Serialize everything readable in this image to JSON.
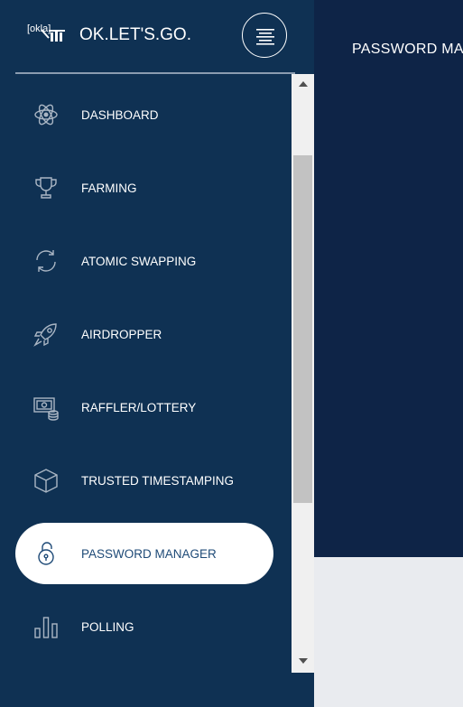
{
  "brand": {
    "logo_text": "[okla]",
    "name": "OK.LET'S.GO."
  },
  "header": {
    "page_title": "PASSWORD MA"
  },
  "sidebar": {
    "items": [
      {
        "label": "DASHBOARD",
        "icon": "atom-icon"
      },
      {
        "label": "FARMING",
        "icon": "trophy-icon"
      },
      {
        "label": "ATOMIC SWAPPING",
        "icon": "refresh-icon"
      },
      {
        "label": "AIRDROPPER",
        "icon": "rocket-icon"
      },
      {
        "label": "RAFFLER/LOTTERY",
        "icon": "money-coins-icon"
      },
      {
        "label": "TRUSTED TIMESTAMPING",
        "icon": "cube-icon"
      },
      {
        "label": "PASSWORD MANAGER",
        "icon": "unlock-icon",
        "active": true
      },
      {
        "label": "POLLING",
        "icon": "bar-chart-icon"
      }
    ]
  },
  "colors": {
    "sidebar_bg": "#0f3153",
    "main_bg": "#0e2447",
    "content_bg": "#e9ebef",
    "active_text": "#1e4a77",
    "icon_stroke": "#aab6c4"
  }
}
